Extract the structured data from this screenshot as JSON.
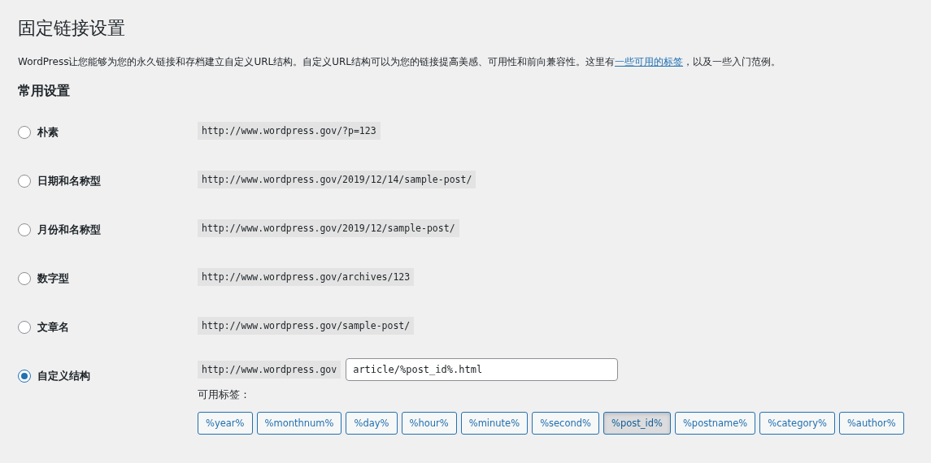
{
  "title": "固定链接设置",
  "intro": {
    "before": "WordPress让您能够为您的永久链接和存档建立自定义URL结构。自定义URL结构可以为您的链接提高美感、可用性和前向兼容性。这里有",
    "link": "一些可用的标签",
    "after": "，以及一些入门范例。"
  },
  "section_title": "常用设置",
  "options": [
    {
      "label": "朴素",
      "example": "http://www.wordpress.gov/?p=123",
      "selected": false,
      "kind": "preset"
    },
    {
      "label": "日期和名称型",
      "example": "http://www.wordpress.gov/2019/12/14/sample-post/",
      "selected": false,
      "kind": "preset"
    },
    {
      "label": "月份和名称型",
      "example": "http://www.wordpress.gov/2019/12/sample-post/",
      "selected": false,
      "kind": "preset"
    },
    {
      "label": "数字型",
      "example": "http://www.wordpress.gov/archives/123",
      "selected": false,
      "kind": "preset"
    },
    {
      "label": "文章名",
      "example": "http://www.wordpress.gov/sample-post/",
      "selected": false,
      "kind": "preset"
    },
    {
      "label": "自定义结构",
      "example": "http://www.wordpress.gov",
      "selected": true,
      "kind": "custom",
      "value": "article/%post_id%.html",
      "tags_label": "可用标签：",
      "tags": [
        {
          "label": "%year%",
          "selected": false
        },
        {
          "label": "%monthnum%",
          "selected": false
        },
        {
          "label": "%day%",
          "selected": false
        },
        {
          "label": "%hour%",
          "selected": false
        },
        {
          "label": "%minute%",
          "selected": false
        },
        {
          "label": "%second%",
          "selected": false
        },
        {
          "label": "%post_id%",
          "selected": true
        },
        {
          "label": "%postname%",
          "selected": false
        },
        {
          "label": "%category%",
          "selected": false
        },
        {
          "label": "%author%",
          "selected": false
        }
      ]
    }
  ]
}
